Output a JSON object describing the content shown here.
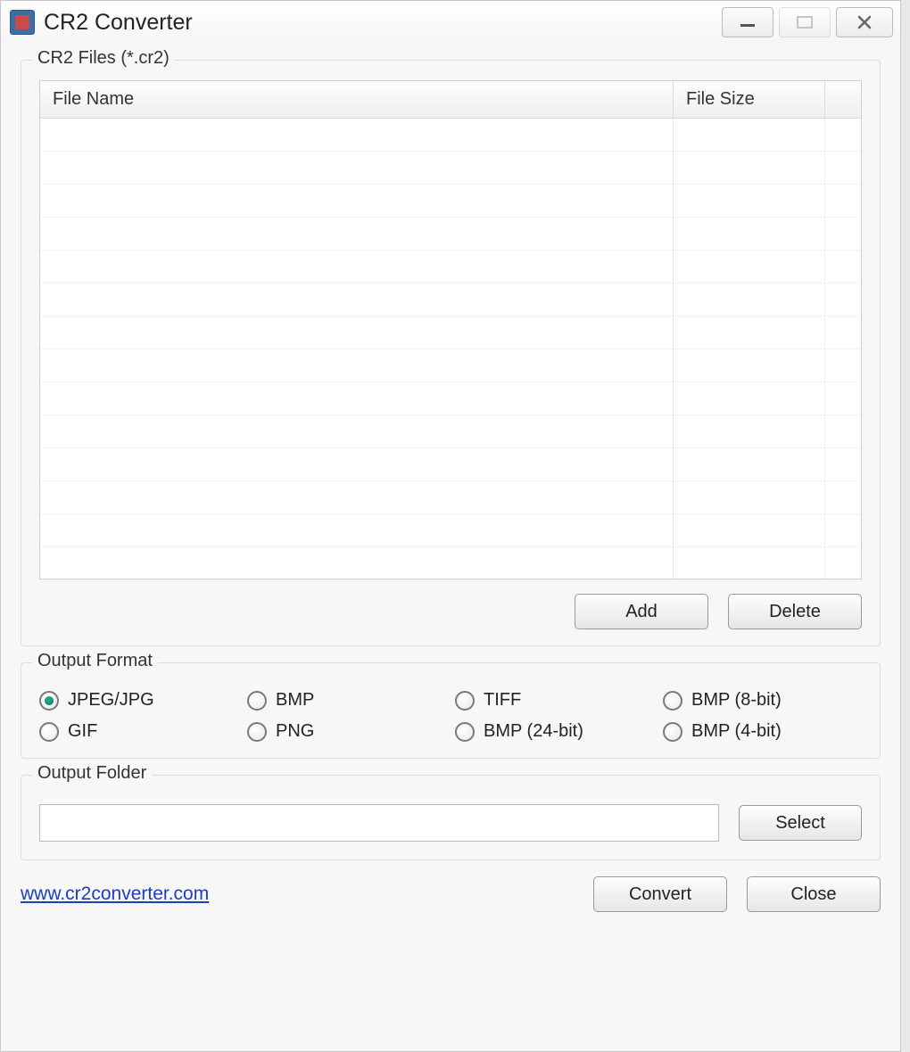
{
  "window": {
    "title": "CR2 Converter"
  },
  "files_group": {
    "label": "CR2 Files (*.cr2)",
    "columns": {
      "name": "File Name",
      "size": "File Size"
    },
    "rows": [],
    "buttons": {
      "add": "Add",
      "delete": "Delete"
    }
  },
  "output_format": {
    "label": "Output Format",
    "selected": "JPEG/JPG",
    "options": [
      "JPEG/JPG",
      "BMP",
      "TIFF",
      "BMP (8-bit)",
      "GIF",
      "PNG",
      "BMP (24-bit)",
      "BMP (4-bit)"
    ]
  },
  "output_folder": {
    "label": "Output Folder",
    "path": "",
    "select_label": "Select"
  },
  "footer": {
    "link": "www.cr2converter.com",
    "convert": "Convert",
    "close": "Close"
  }
}
